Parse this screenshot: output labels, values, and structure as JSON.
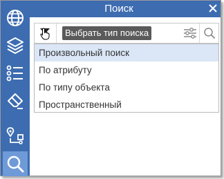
{
  "window": {
    "title": "Поиск",
    "accent_color": "#3d6cb0",
    "sidebar_active_color": "#6f9ad8"
  },
  "sidebar": {
    "items": [
      {
        "icon": "globe-icon"
      },
      {
        "icon": "layers-icon"
      },
      {
        "icon": "list-icon"
      },
      {
        "icon": "eraser-icon"
      },
      {
        "icon": "route-icon"
      },
      {
        "icon": "search-icon",
        "active": true
      }
    ]
  },
  "search": {
    "type_tooltip": "Выбрать тип поиска",
    "filter_icon": "sliders-icon",
    "search_icon": "magnifier-icon"
  },
  "dropdown": {
    "options": [
      {
        "label": "Произвольный поиск",
        "selected": true
      },
      {
        "label": "По атрибуту"
      },
      {
        "label": "По типу объекта"
      },
      {
        "label": "Пространственный"
      }
    ]
  }
}
